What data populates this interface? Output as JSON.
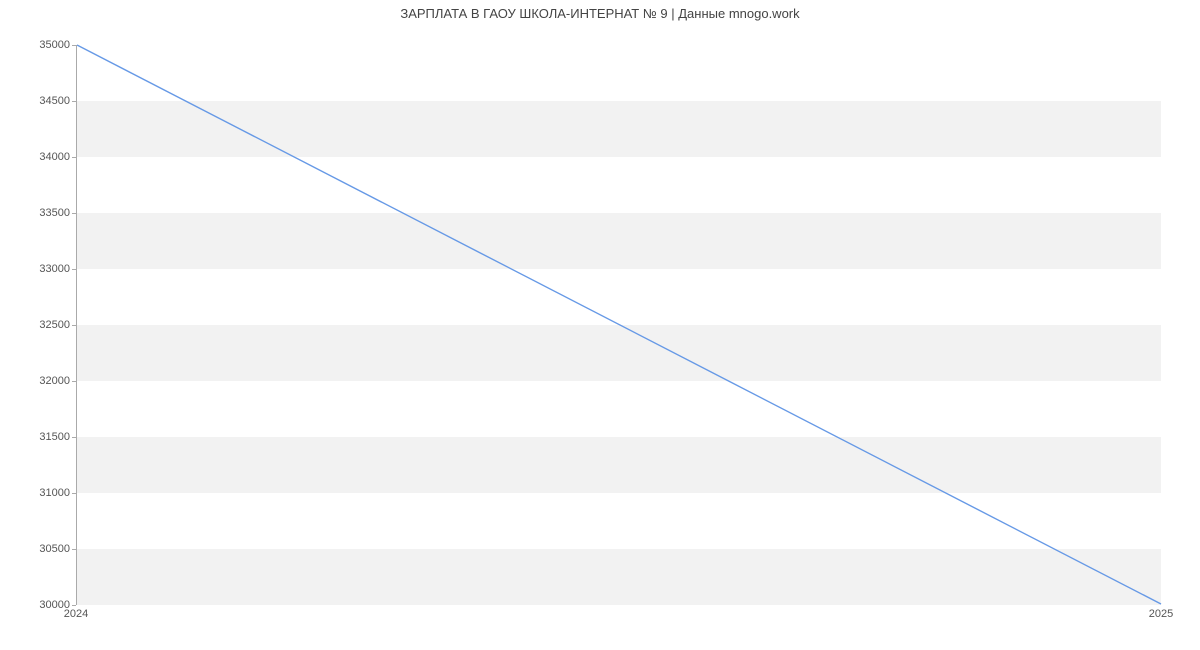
{
  "chart_data": {
    "type": "line",
    "title": "ЗАРПЛАТА В ГАОУ ШКОЛА-ИНТЕРНАТ № 9 | Данные mnogo.work",
    "x": [
      "2024",
      "2025"
    ],
    "values": [
      35000,
      30000
    ],
    "xlabel": "",
    "ylabel": "",
    "ylim": [
      30000,
      35000
    ],
    "y_ticks": [
      30000,
      30500,
      31000,
      31500,
      32000,
      32500,
      33000,
      33500,
      34000,
      34500,
      35000
    ],
    "x_ticks": [
      "2024",
      "2025"
    ],
    "line_color": "#6699e6"
  }
}
